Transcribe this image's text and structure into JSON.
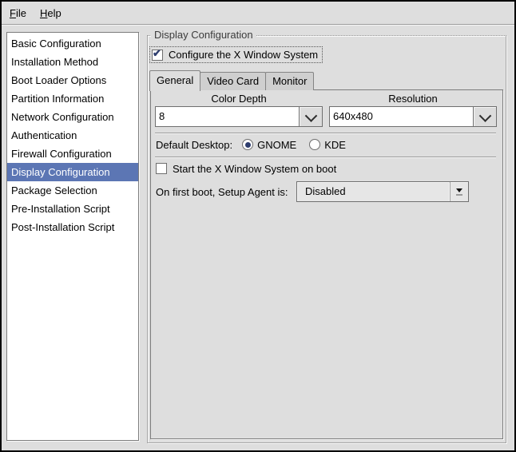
{
  "menubar": {
    "items": [
      {
        "first": "F",
        "rest": "ile"
      },
      {
        "first": "H",
        "rest": "elp"
      }
    ]
  },
  "sidebar": {
    "items": [
      {
        "label": "Basic Configuration",
        "selected": false
      },
      {
        "label": "Installation Method",
        "selected": false
      },
      {
        "label": "Boot Loader Options",
        "selected": false
      },
      {
        "label": "Partition Information",
        "selected": false
      },
      {
        "label": "Network Configuration",
        "selected": false
      },
      {
        "label": "Authentication",
        "selected": false
      },
      {
        "label": "Firewall Configuration",
        "selected": false
      },
      {
        "label": "Display Configuration",
        "selected": true
      },
      {
        "label": "Package Selection",
        "selected": false
      },
      {
        "label": "Pre-Installation Script",
        "selected": false
      },
      {
        "label": "Post-Installation Script",
        "selected": false
      }
    ]
  },
  "display": {
    "frame_title": "Display Configuration",
    "configure_x": {
      "label": "Configure the X Window System",
      "checked": true
    },
    "tabs": [
      {
        "label": "General",
        "active": true
      },
      {
        "label": "Video Card",
        "active": false
      },
      {
        "label": "Monitor",
        "active": false
      }
    ],
    "general": {
      "color_depth": {
        "label": "Color Depth",
        "value": "8"
      },
      "resolution": {
        "label": "Resolution",
        "value": "640x480"
      },
      "default_desktop": {
        "label": "Default Desktop:",
        "options": [
          {
            "label": "GNOME",
            "selected": true
          },
          {
            "label": "KDE",
            "selected": false
          }
        ]
      },
      "start_x": {
        "label": "Start the X Window System on boot",
        "checked": false
      },
      "setup_agent": {
        "label": "On first boot, Setup Agent is:",
        "value": "Disabled"
      }
    }
  },
  "colors": {
    "selection": "#5c76b4",
    "check": "#2e3d6e",
    "window_bg": "#dedede"
  }
}
